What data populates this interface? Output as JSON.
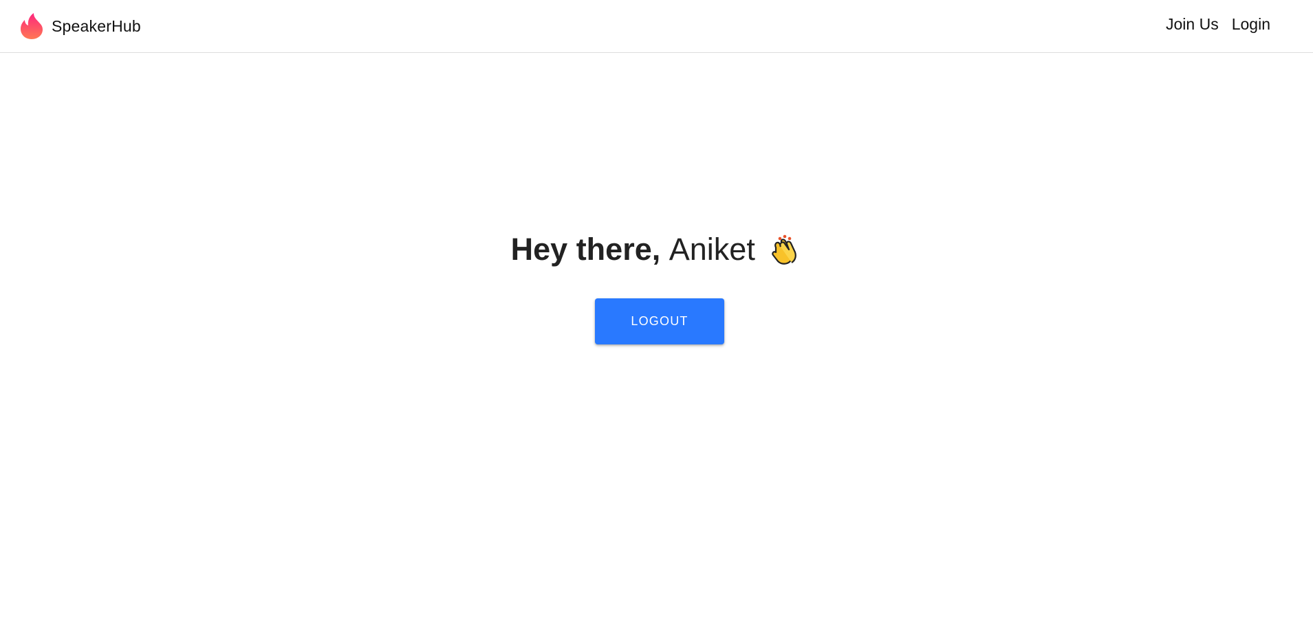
{
  "navbar": {
    "brand": {
      "name": "SpeakerHub",
      "logo_icon": "flame-icon",
      "logo_colors": [
        "#fd267d",
        "#ff7854"
      ]
    },
    "links": [
      {
        "label": "Join Us"
      },
      {
        "label": "Login"
      }
    ]
  },
  "main": {
    "greeting_prefix": "Hey there,",
    "user_name": "Aniket",
    "greeting_icon": "clapping-hands-icon",
    "logout_label": "LOGOUT",
    "accent_color": "#2979ff"
  }
}
